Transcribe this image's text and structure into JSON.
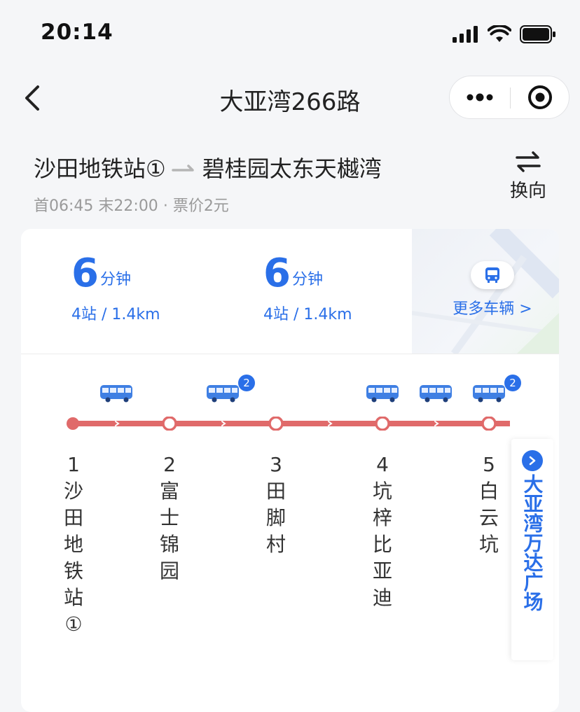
{
  "status_bar": {
    "time": "20:14"
  },
  "nav": {
    "title": "大亚湾266路"
  },
  "route": {
    "from": "沙田地铁站①",
    "to": "碧桂园太东天樾湾",
    "first_bus": "首06:45",
    "last_bus": "末22:00",
    "separator": "·",
    "fare": "票价2元",
    "switch_label": "换向"
  },
  "arrivals": [
    {
      "minutes": "6",
      "unit": "分钟",
      "detail": "4站 / 1.4km"
    },
    {
      "minutes": "6",
      "unit": "分钟",
      "detail": "4站 / 1.4km"
    }
  ],
  "more_buses_label": "更多车辆 >",
  "stops": [
    {
      "num": "1",
      "name": "沙田地铁站①"
    },
    {
      "num": "2",
      "name": "富士锦园"
    },
    {
      "num": "3",
      "name": "田脚村"
    },
    {
      "num": "4",
      "name": "坑梓比亚迪"
    },
    {
      "num": "5",
      "name": "白云坑"
    }
  ],
  "bus_badges": [
    "2",
    "2"
  ],
  "terminal_stop": "大亚湾万达广场",
  "colors": {
    "accent_blue": "#2a6fe8",
    "route_red": "#e06a6a",
    "background": "#f5f6f8"
  }
}
